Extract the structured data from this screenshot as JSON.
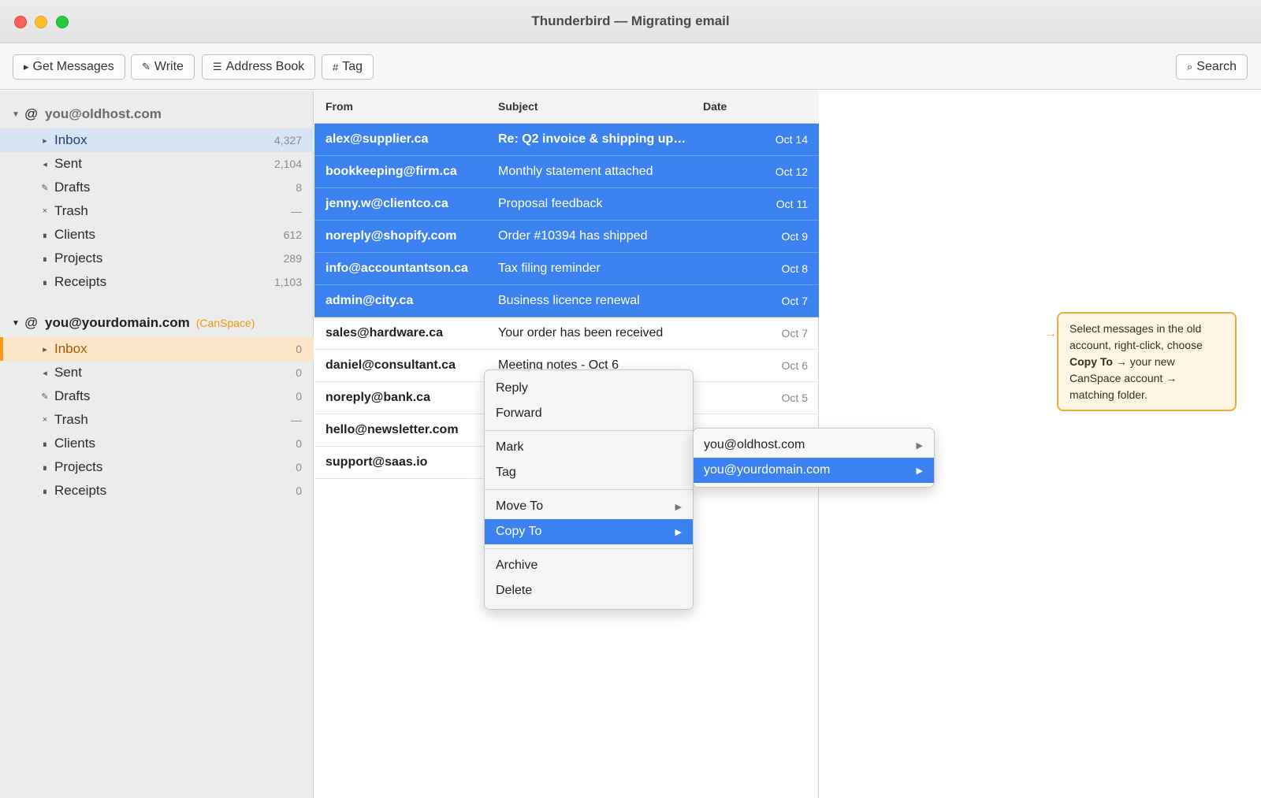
{
  "window": {
    "title": "Thunderbird — Migrating email"
  },
  "toolbar": {
    "get_messages": {
      "icon": "▸",
      "label": "Get Messages"
    },
    "write": {
      "icon": "✎",
      "label": "Write"
    },
    "address_book": {
      "icon": "☰",
      "label": "Address Book"
    },
    "tag": {
      "icon": "#",
      "label": "Tag"
    },
    "search": {
      "icon": "⌕",
      "label": "Search"
    }
  },
  "sidebar": {
    "accounts": [
      {
        "name": "you@oldhost.com",
        "tag": "",
        "folders": [
          {
            "icon": "▸",
            "name": "Inbox",
            "count": "4,327"
          },
          {
            "icon": "◂",
            "name": "Sent",
            "count": "2,104"
          },
          {
            "icon": "✎",
            "name": "Drafts",
            "count": "8"
          },
          {
            "icon": "×",
            "name": "Trash",
            "count": "—"
          },
          {
            "icon": "∎",
            "name": "Clients",
            "count": "612"
          },
          {
            "icon": "∎",
            "name": "Projects",
            "count": "289"
          },
          {
            "icon": "∎",
            "name": "Receipts",
            "count": "1,103"
          }
        ]
      },
      {
        "name": "you@yourdomain.com",
        "tag": "(CanSpace)",
        "folders": [
          {
            "icon": "▸",
            "name": "Inbox",
            "count": "0"
          },
          {
            "icon": "◂",
            "name": "Sent",
            "count": "0"
          },
          {
            "icon": "✎",
            "name": "Drafts",
            "count": "0"
          },
          {
            "icon": "×",
            "name": "Trash",
            "count": "—"
          },
          {
            "icon": "∎",
            "name": "Clients",
            "count": "0"
          },
          {
            "icon": "∎",
            "name": "Projects",
            "count": "0"
          },
          {
            "icon": "∎",
            "name": "Receipts",
            "count": "0"
          }
        ]
      }
    ]
  },
  "message_list": {
    "columns": {
      "from": "From",
      "subject": "Subject",
      "date": "Date"
    },
    "rows": [
      {
        "from": "alex@supplier.ca",
        "subject": "Re: Q2 invoice & shipping up…",
        "date": "Oct 14",
        "selected": true
      },
      {
        "from": "bookkeeping@firm.ca",
        "subject": "Monthly statement attached",
        "date": "Oct 12",
        "selected": true
      },
      {
        "from": "jenny.w@clientco.ca",
        "subject": "Proposal feedback",
        "date": "Oct 11",
        "selected": true
      },
      {
        "from": "noreply@shopify.com",
        "subject": "Order #10394 has shipped",
        "date": "Oct 9",
        "selected": true
      },
      {
        "from": "info@accountantson.ca",
        "subject": "Tax filing reminder",
        "date": "Oct 8",
        "selected": true
      },
      {
        "from": "admin@city.ca",
        "subject": "Business licence renewal",
        "date": "Oct 7",
        "selected": true
      },
      {
        "from": "sales@hardware.ca",
        "subject": "Your order has been received",
        "date": "Oct 7",
        "selected": false
      },
      {
        "from": "daniel@consultant.ca",
        "subject": "Meeting notes - Oct 6",
        "date": "Oct 6",
        "selected": false
      },
      {
        "from": "noreply@bank.ca",
        "subject": "",
        "date": "Oct 5",
        "selected": false
      },
      {
        "from": "hello@newsletter.com",
        "subject": "",
        "date": "",
        "selected": false
      },
      {
        "from": "support@saas.io",
        "subject": "",
        "date": "",
        "selected": false
      }
    ]
  },
  "context_menu": {
    "reply": "Reply",
    "forward": "Forward",
    "mark": "Mark",
    "tag": "Tag",
    "move_to": "Move To",
    "copy_to": "Copy To",
    "archive": "Archive",
    "delete": "Delete",
    "submenu_arrow": "▶"
  },
  "submenu": {
    "items": [
      "you@oldhost.com",
      "you@yourdomain.com"
    ]
  },
  "callout": {
    "arrow": "→",
    "text_1": "Select messages in the old account, right-click, choose ",
    "bold": "Copy To",
    "text_2": " → your new CanSpace account → matching folder."
  },
  "colors": {
    "selection_blue": "#3b82f0",
    "accent_orange": "#f2a93b"
  }
}
